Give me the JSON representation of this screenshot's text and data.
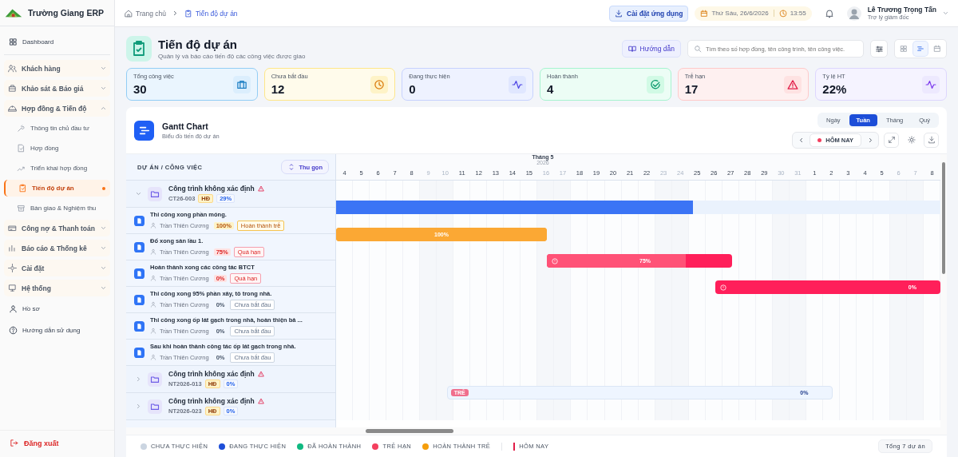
{
  "sidebar": {
    "brand": "Trường Giang ERP",
    "items": [
      {
        "kind": "link",
        "label": "Dashboard",
        "selected": false
      },
      {
        "kind": "group",
        "label": "Khách hàng",
        "expanded": false
      },
      {
        "kind": "group",
        "label": "Khảo sát & Báo giá",
        "expanded": false
      },
      {
        "kind": "group",
        "label": "Hợp đồng & Tiến độ",
        "expanded": true,
        "children": [
          {
            "label": "Thông tin chủ đầu tư",
            "selected": false
          },
          {
            "label": "Hợp đồng",
            "selected": false
          },
          {
            "label": "Triển khai hợp đồng",
            "selected": false
          },
          {
            "label": "Tiến độ dự án",
            "selected": true
          },
          {
            "label": "Bàn giao & Nghiệm thu",
            "selected": false
          }
        ]
      },
      {
        "kind": "group",
        "label": "Công nợ & Thanh toán",
        "expanded": false
      },
      {
        "kind": "group",
        "label": "Báo cáo & Thống kê",
        "expanded": false
      },
      {
        "kind": "group",
        "label": "Cài đặt",
        "expanded": false
      },
      {
        "kind": "group",
        "label": "Hệ thống",
        "expanded": false
      },
      {
        "kind": "link",
        "label": "Hồ sơ",
        "selected": false
      },
      {
        "kind": "link",
        "label": "Hướng dẫn sử dụng",
        "selected": false
      }
    ],
    "logout": "Đăng xuất"
  },
  "topbar": {
    "breadcrumb": [
      "Trang chủ",
      "Tiến độ dự án"
    ],
    "install_button": "Cài đặt ứng dụng",
    "date": "Thứ Sáu, 26/6/2026",
    "time": "13:55",
    "user": {
      "name": "Lê Trương Trọng Tấn",
      "role": "Trợ lý giám đốc"
    }
  },
  "page": {
    "title": "Tiến độ dự án",
    "subtitle": "Quản lý và báo cáo tiến độ các công việc được giao",
    "guide_button": "Hướng dẫn",
    "search": {
      "placeholder": "Tìm theo số hợp đồng, tên công trình, tên công việc."
    },
    "view_modes": [
      {
        "selected": false
      },
      {
        "selected": true
      },
      {
        "selected": false
      }
    ]
  },
  "stats": [
    {
      "kind": "total",
      "label": "Tổng công việc",
      "value": "30"
    },
    {
      "kind": "not_started",
      "label": "Chưa bắt đầu",
      "value": "12"
    },
    {
      "kind": "in_progress",
      "label": "Đang thực hiện",
      "value": "0"
    },
    {
      "kind": "done",
      "label": "Hoàn thành",
      "value": "4"
    },
    {
      "kind": "late",
      "label": "Trễ hạn",
      "value": "17"
    },
    {
      "kind": "rate",
      "label": "Tỷ lệ HT",
      "value": "22%"
    }
  ],
  "gantt": {
    "title": "Gantt Chart",
    "subtitle": "Biểu đồ tiến độ dự án",
    "scales": [
      {
        "label": "Ngày",
        "selected": false
      },
      {
        "label": "Tuần",
        "selected": true
      },
      {
        "label": "Tháng",
        "selected": false
      },
      {
        "label": "Quý",
        "selected": false
      }
    ],
    "today_button": "HÔM NAY",
    "list_header": "DỰ ÁN / CÔNG VIỆC",
    "collapse_button": "Thu gọn",
    "timeline": {
      "month": "Tháng 5",
      "year": "2026",
      "days": [
        {
          "label": "4",
          "weekend": false
        },
        {
          "label": "5",
          "weekend": false
        },
        {
          "label": "6",
          "weekend": false
        },
        {
          "label": "7",
          "weekend": false
        },
        {
          "label": "8",
          "weekend": false
        },
        {
          "label": "9",
          "weekend": true
        },
        {
          "label": "10",
          "weekend": true
        },
        {
          "label": "11",
          "weekend": false
        },
        {
          "label": "12",
          "weekend": false
        },
        {
          "label": "13",
          "weekend": false
        },
        {
          "label": "14",
          "weekend": false
        },
        {
          "label": "15",
          "weekend": false
        },
        {
          "label": "16",
          "weekend": true
        },
        {
          "label": "17",
          "weekend": true
        },
        {
          "label": "18",
          "weekend": false
        },
        {
          "label": "19",
          "weekend": false
        },
        {
          "label": "20",
          "weekend": false
        },
        {
          "label": "21",
          "weekend": false
        },
        {
          "label": "22",
          "weekend": false
        },
        {
          "label": "23",
          "weekend": true
        },
        {
          "label": "24",
          "weekend": true
        },
        {
          "label": "25",
          "weekend": false
        },
        {
          "label": "26",
          "weekend": false
        },
        {
          "label": "27",
          "weekend": false
        },
        {
          "label": "28",
          "weekend": false
        },
        {
          "label": "29",
          "weekend": false
        },
        {
          "label": "30",
          "weekend": true
        },
        {
          "label": "31",
          "weekend": true
        },
        {
          "label": "1",
          "weekend": false
        },
        {
          "label": "2",
          "weekend": false
        },
        {
          "label": "3",
          "weekend": false
        },
        {
          "label": "4",
          "weekend": false
        },
        {
          "label": "5",
          "weekend": false
        },
        {
          "label": "6",
          "weekend": true
        },
        {
          "label": "7",
          "weekend": true
        },
        {
          "label": "8",
          "weekend": false
        }
      ]
    },
    "rows": [
      {
        "kind": "project",
        "name": "Công trình không xác định",
        "warning": true,
        "code": "CT26-003",
        "contract_tag": "HĐ",
        "progress": "29%",
        "expanded": true,
        "bar": {
          "kind": "in_progress",
          "level": 0.59
        }
      },
      {
        "kind": "task",
        "title": "Thi công xong phần móng.",
        "assignee": "Trần Thiên Cương",
        "percent": "100%",
        "tag": {
          "kind": "late_done",
          "label": "Hoàn thành trễ"
        },
        "bar": {
          "kind": "late_done",
          "label": "100%",
          "level": 1
        }
      },
      {
        "kind": "task",
        "title": "Đổ xong sàn lầu 1.",
        "assignee": "Trần Thiên Cương",
        "percent": "75%",
        "tag": {
          "kind": "overdue",
          "label": "Quá hạn"
        },
        "bar": {
          "kind": "overdue",
          "label": "75%",
          "level": 0.75
        }
      },
      {
        "kind": "task",
        "title": "Hoàn thành xong các công tác BTCT",
        "assignee": "Trần Thiên Cương",
        "percent": "0%",
        "tag": {
          "kind": "overdue",
          "label": "Quá hạn"
        },
        "bar": {
          "kind": "overdue",
          "label": "0%"
        }
      },
      {
        "kind": "task",
        "title": "Thi công xong 95% phần xây, tô trong nhà.",
        "assignee": "Trần Thiên Cương",
        "percent": "0%",
        "tag": {
          "kind": "not_started",
          "label": "Chưa bắt đầu"
        }
      },
      {
        "kind": "task",
        "title": "Thi công xong ốp lát gạch trong nhà, hoàn thiện bả ...",
        "assignee": "Trần Thiên Cương",
        "percent": "0%",
        "tag": {
          "kind": "not_started",
          "label": "Chưa bắt đầu"
        }
      },
      {
        "kind": "task",
        "title": "Sau khi hoàn thành công tác ốp lát gạch trong nhà.",
        "assignee": "Trần Thiên Cương",
        "percent": "0%",
        "tag": {
          "kind": "not_started",
          "label": "Chưa bắt đầu"
        }
      },
      {
        "kind": "project",
        "name": "Công trình không xác định",
        "warning": true,
        "code": "NT2026-013",
        "contract_tag": "HĐ",
        "progress": "0%",
        "expanded": false,
        "bar": {
          "kind": "late",
          "tag": "TRỄ",
          "label": "0%"
        }
      },
      {
        "kind": "project",
        "name": "Công trình không xác định",
        "warning": true,
        "code": "NT2026-023",
        "contract_tag": "HĐ",
        "progress": "0%",
        "expanded": false
      }
    ],
    "legend": [
      {
        "label": "CHƯA THỰC HIỆN",
        "color": "#cbd5e1"
      },
      {
        "label": "ĐANG THỰC HIỆN",
        "color": "#1d4ed8"
      },
      {
        "label": "ĐÃ HOÀN THÀNH",
        "color": "#10b981"
      },
      {
        "label": "TRỄ HẠN",
        "color": "#f43f5e"
      },
      {
        "label": "HOÀN THÀNH TRỄ",
        "color": "#f59e0b"
      }
    ],
    "today_legend": "HÔM NAY",
    "total": "Tổng 7 dự án"
  }
}
